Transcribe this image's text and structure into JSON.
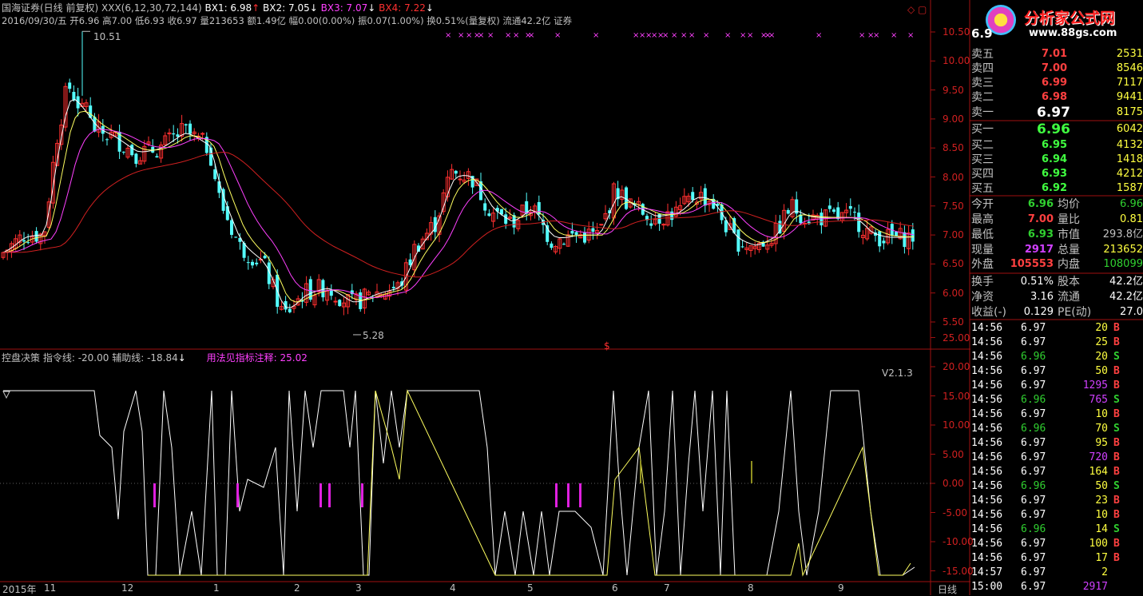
{
  "header": {
    "name": "国海证券(日线 前复权)",
    "indicator": "XXX(6,12,30,72,144)",
    "bx1": "BX1: 6.98",
    "bx2": "BX2: 7.05",
    "bx3": "BX3: 7.07",
    "bx4": "BX4: 7.22",
    "quote_line": "2016/09/30/五 开6.96 高7.00 低6.93 收6.97 量213653 额1.49亿 幅0.00(0.00%) 振0.07(1.00%) 换0.51%(量复权) 流通42.2亿 证券",
    "hi_label": "10.51",
    "lo_label": "5.28",
    "dollar": "$"
  },
  "sub": {
    "title": "控盘决策",
    "cmd": "指令线: -20.00",
    "aux": "辅助线: -18.84",
    "note": "用法见指标注释: 25.02",
    "version": "V2.1.3"
  },
  "price_axis": [
    "10.50",
    "10.00",
    "9.50",
    "9.00",
    "8.50",
    "8.00",
    "7.50",
    "7.00",
    "6.50",
    "6.00",
    "5.50"
  ],
  "sub_axis": [
    "25.00",
    "20.00",
    "15.00",
    "10.00",
    "5.00",
    "0.00",
    "-5.00",
    "-10.00",
    "-15.00"
  ],
  "x_axis": {
    "year": "2015年",
    "m1": "11",
    "m2": "12",
    "m3": "1",
    "m4": "2",
    "m5": "3",
    "m6": "4",
    "m7": "5",
    "m8": "6",
    "m9": "7",
    "m10": "8",
    "m11": "9",
    "period": "日线"
  },
  "logo": {
    "name": "分析家公式网",
    "url": "www.88gs.com"
  },
  "panel": {
    "top_price": "6.9",
    "sells": [
      {
        "label": "卖五",
        "price": "7.01",
        "vol": "2531"
      },
      {
        "label": "卖四",
        "price": "7.00",
        "vol": "8546"
      },
      {
        "label": "卖三",
        "price": "6.99",
        "vol": "7117"
      },
      {
        "label": "卖二",
        "price": "6.98",
        "vol": "9441"
      },
      {
        "label": "卖一",
        "price": "6.97",
        "vol": "8175"
      }
    ],
    "buys": [
      {
        "label": "买一",
        "price": "6.96",
        "vol": "6042"
      },
      {
        "label": "买二",
        "price": "6.95",
        "vol": "4132"
      },
      {
        "label": "买三",
        "price": "6.94",
        "vol": "1418"
      },
      {
        "label": "买四",
        "price": "6.93",
        "vol": "4212"
      },
      {
        "label": "买五",
        "price": "6.92",
        "vol": "1587"
      }
    ],
    "stats": [
      {
        "l1": "今开",
        "v1": "6.96",
        "l2": "均价",
        "v2": "6.96"
      },
      {
        "l1": "最高",
        "v1": "7.00",
        "l2": "量比",
        "v2": "0.81"
      },
      {
        "l1": "最低",
        "v1": "6.93",
        "l2": "市值",
        "v2": "293.8亿"
      },
      {
        "l1": "现量",
        "v1": "2917",
        "l2": "总量",
        "v2": "213652"
      },
      {
        "l1": "外盘",
        "v1": "105553",
        "l2": "内盘",
        "v2": "108099"
      }
    ],
    "stats2": [
      {
        "l1": "换手",
        "v1": "0.51%",
        "l2": "股本",
        "v2": "42.2亿"
      },
      {
        "l1": "净资",
        "v1": "3.16",
        "l2": "流通",
        "v2": "42.2亿"
      },
      {
        "l1": "收益(-)",
        "v1": "0.129",
        "l2": "PE(动)",
        "v2": "27.0"
      }
    ],
    "ticks": [
      {
        "t": "14:56",
        "p": "6.97",
        "v": "20",
        "s": "B"
      },
      {
        "t": "14:56",
        "p": "6.97",
        "v": "25",
        "s": "B"
      },
      {
        "t": "14:56",
        "p": "6.96",
        "v": "20",
        "s": "S"
      },
      {
        "t": "14:56",
        "p": "6.97",
        "v": "50",
        "s": "B"
      },
      {
        "t": "14:56",
        "p": "6.97",
        "v": "1295",
        "s": "B"
      },
      {
        "t": "14:56",
        "p": "6.96",
        "v": "765",
        "s": "S"
      },
      {
        "t": "14:56",
        "p": "6.97",
        "v": "10",
        "s": "B"
      },
      {
        "t": "14:56",
        "p": "6.96",
        "v": "70",
        "s": "S"
      },
      {
        "t": "14:56",
        "p": "6.97",
        "v": "95",
        "s": "B"
      },
      {
        "t": "14:56",
        "p": "6.97",
        "v": "720",
        "s": "B"
      },
      {
        "t": "14:56",
        "p": "6.97",
        "v": "164",
        "s": "B"
      },
      {
        "t": "14:56",
        "p": "6.96",
        "v": "50",
        "s": "S"
      },
      {
        "t": "14:56",
        "p": "6.97",
        "v": "23",
        "s": "B"
      },
      {
        "t": "14:56",
        "p": "6.97",
        "v": "10",
        "s": "B"
      },
      {
        "t": "14:56",
        "p": "6.96",
        "v": "14",
        "s": "S"
      },
      {
        "t": "14:56",
        "p": "6.97",
        "v": "100",
        "s": "B"
      },
      {
        "t": "14:56",
        "p": "6.97",
        "v": "17",
        "s": "B"
      },
      {
        "t": "14:57",
        "p": "6.97",
        "v": "2",
        "s": ""
      },
      {
        "t": "15:00",
        "p": "6.97",
        "v": "2917",
        "s": ""
      }
    ]
  },
  "colors": {
    "up": "#ff3030",
    "down": "#54ffff",
    "ma_white": "#ffffff",
    "ma_yellow": "#ffff60",
    "ma_pink": "#ff40ff",
    "ma_red": "#d02020",
    "grid": "#a01010",
    "green": "#30d030",
    "purple": "#d040ff"
  }
}
